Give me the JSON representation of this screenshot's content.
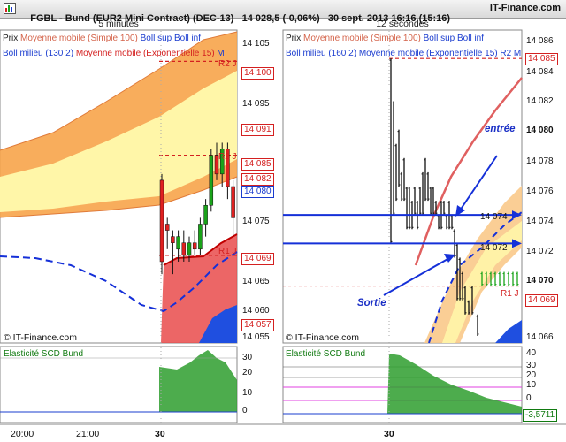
{
  "header": {
    "instrument": "FGBL - Bund (EUR2 Mini Contract) (DEC-13)",
    "quote": "14 028,5 (-0,06%)",
    "datetime": "30 sept. 2013 16:16 (15:16)",
    "source": "IT-Finance.com"
  },
  "colors": {
    "bull": "#1aa31a",
    "bear": "#e02020",
    "price_line": "#1530d8",
    "band_red": "#e94b4b",
    "band_yellow": "#fff6a8",
    "band_orange": "#f7a44a"
  },
  "chart_data": [
    {
      "type": "candlestick",
      "title": "5 minutes",
      "legend": [
        {
          "label": "Prix",
          "color": "#222222"
        },
        {
          "label": "Moyenne mobile (Simple 100)",
          "color": "#d4634a"
        },
        {
          "label": "Boll sup Boll inf",
          "color": "#1a3ccf"
        },
        {
          "label": "Boll milieu (130 2)",
          "color": "#1a3ccf"
        },
        {
          "label": "Moyenne mobile (Exponentielle 15)",
          "color": "#d42020"
        },
        {
          "label": "M",
          "color": "#1a3ccf"
        }
      ],
      "yticks": [
        "14 105",
        "14 100",
        "14 095",
        "14 091",
        "14 085",
        "14 082",
        "14 080",
        "14 075",
        "14 069",
        "14 065",
        "14 060",
        "14 057",
        "14 055"
      ],
      "ylim": [
        14055,
        14105
      ],
      "level_markers": [
        {
          "label": "R2 J",
          "value": 14100
        },
        {
          "label": "R2 J",
          "value": 14085
        },
        {
          "label": "R1 J",
          "value": 14069
        }
      ],
      "value_boxes": [
        {
          "label": "14 100",
          "color": "#d42020"
        },
        {
          "label": "14 091",
          "color": "#d42020"
        },
        {
          "label": "14 085",
          "color": "#d42020"
        },
        {
          "label": "14 082",
          "color": "#d42020"
        },
        {
          "label": "14 080",
          "color": "#1a3ccf"
        },
        {
          "label": "14 069",
          "color": "#d42020"
        },
        {
          "label": "14 057",
          "color": "#d42020"
        }
      ],
      "candles": [
        {
          "o": 14081,
          "h": 14082,
          "l": 14066,
          "c": 14068
        },
        {
          "o": 14074,
          "h": 14075,
          "l": 14070,
          "c": 14073
        },
        {
          "o": 14072,
          "h": 14073,
          "l": 14066,
          "c": 14071
        },
        {
          "o": 14070,
          "h": 14073,
          "l": 14068,
          "c": 14072
        },
        {
          "o": 14071,
          "h": 14073,
          "l": 14068,
          "c": 14069
        },
        {
          "o": 14069,
          "h": 14072,
          "l": 14068,
          "c": 14071
        },
        {
          "o": 14071,
          "h": 14073,
          "l": 14069,
          "c": 14070
        },
        {
          "o": 14070,
          "h": 14075,
          "l": 14069,
          "c": 14074
        },
        {
          "o": 14074,
          "h": 14078,
          "l": 14072,
          "c": 14077
        },
        {
          "o": 14077,
          "h": 14086,
          "l": 14076,
          "c": 14085
        },
        {
          "o": 14085,
          "h": 14087,
          "l": 14081,
          "c": 14082
        },
        {
          "o": 14082,
          "h": 14087,
          "l": 14080,
          "c": 14086
        },
        {
          "o": 14086,
          "h": 14087,
          "l": 14078,
          "c": 14080
        },
        {
          "o": 14080,
          "h": 14081,
          "l": 14072,
          "c": 14075
        }
      ],
      "indicator": {
        "label": "Elasticité SCD Bund",
        "yticks": [
          "30",
          "20",
          "10",
          "0"
        ]
      },
      "xticks": [
        "20:00",
        "21:00",
        "30"
      ],
      "copyright": "© IT-Finance.com"
    },
    {
      "type": "bar-ohlc",
      "title": "12 secondes",
      "legend": [
        {
          "label": "Prix",
          "color": "#222222"
        },
        {
          "label": "Moyenne mobile (Simple 100)",
          "color": "#d4634a"
        },
        {
          "label": "Boll sup Boll inf",
          "color": "#1a3ccf"
        },
        {
          "label": "Boll milieu (160 2)",
          "color": "#1a3ccf"
        },
        {
          "label": "Moyenne mobile (Exponentielle 15)",
          "color": "#1a3ccf"
        },
        {
          "label": "R2 M",
          "color": "#1a3ccf"
        }
      ],
      "yticks": [
        "14 086",
        "14 084",
        "14 082",
        "14 080",
        "14 078",
        "14 076",
        "14 074",
        "14 072",
        "14 070",
        "14 068",
        "14 066"
      ],
      "ylim": [
        14065,
        14087
      ],
      "value_boxes": [
        {
          "label": "14 085",
          "color": "#d42020"
        },
        {
          "label": "14 070",
          "color": "#111111"
        },
        {
          "label": "14 069",
          "color": "#d42020"
        }
      ],
      "levels": [
        {
          "label": "14 074",
          "value": 14074
        },
        {
          "label": "14 072",
          "value": 14072
        }
      ],
      "r1_label": "R1 J",
      "annotations": {
        "entry": "entrée",
        "exit": "Sortie"
      },
      "indicator": {
        "label": "Elasticité SCD Bund",
        "yticks": [
          "40",
          "30",
          "20",
          "10",
          "0"
        ],
        "last_value": "-3,5711"
      },
      "xticks": [
        "30"
      ],
      "copyright": "© IT-Finance.com"
    }
  ]
}
